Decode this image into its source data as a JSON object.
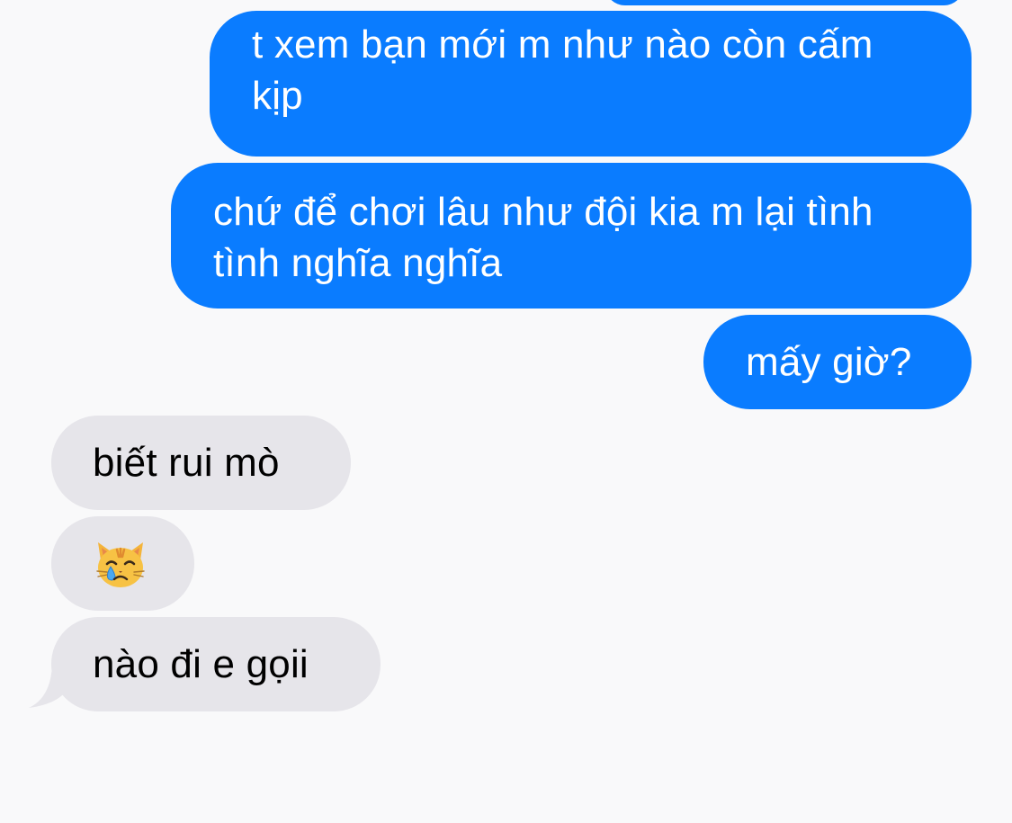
{
  "conversation": {
    "messages": [
      {
        "direction": "sent",
        "lines": [
          "t xem bạn mới m như nào còn cấm",
          "kịp"
        ]
      },
      {
        "direction": "sent",
        "lines": [
          "chứ để chơi lâu như đội kia m lại tình",
          "tình nghĩa nghĩa"
        ]
      },
      {
        "direction": "sent",
        "lines": [
          "mấy giờ?"
        ]
      },
      {
        "direction": "received",
        "lines": [
          "biết rui mò"
        ]
      },
      {
        "direction": "received",
        "emoji": "crying-cat-face-icon"
      },
      {
        "direction": "received",
        "lines": [
          "nào đi e gọii"
        ]
      }
    ]
  },
  "colors": {
    "background": "#f9f9fa",
    "sent_bubble": "#0a7cff",
    "received_bubble": "#e6e5ea",
    "sent_text": "#ffffff",
    "received_text": "#000000"
  }
}
